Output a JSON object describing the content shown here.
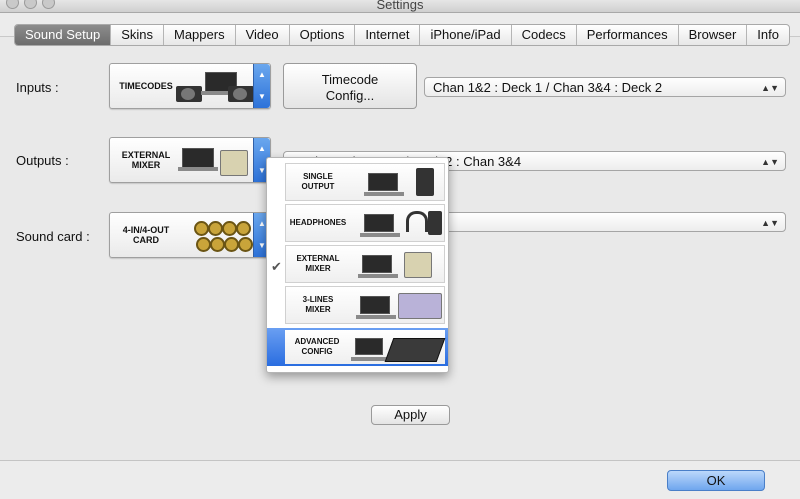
{
  "window": {
    "title": "Settings"
  },
  "tabs": [
    "Sound Setup",
    "Skins",
    "Mappers",
    "Video",
    "Options",
    "Internet",
    "iPhone/iPad",
    "Codecs",
    "Performances",
    "Browser",
    "Info"
  ],
  "active_tab": "Sound Setup",
  "inputs": {
    "label": "Inputs :",
    "device": "TIMECODES",
    "config_button": [
      "Timecode",
      "Config..."
    ],
    "routing": "Chan 1&2 : Deck 1 / Chan 3&4 : Deck 2"
  },
  "outputs": {
    "label": "Outputs :",
    "device": [
      "EXTERNAL",
      "MIXER"
    ],
    "routing": "Deck 1 : Chan 1&2 / Deck 2 : Chan 3&4"
  },
  "soundcard": {
    "label": "Sound card :",
    "device": [
      "4-IN/4-OUT",
      "CARD"
    ],
    "value": ""
  },
  "popup": {
    "items": [
      {
        "label": [
          "SINGLE",
          "OUTPUT"
        ],
        "icon": "single-output-icon"
      },
      {
        "label": [
          "HEADPHONES"
        ],
        "icon": "headphones-icon"
      },
      {
        "label": [
          "EXTERNAL",
          "MIXER"
        ],
        "icon": "external-mixer-icon",
        "checked": true
      },
      {
        "label": [
          "3-LINES",
          "MIXER"
        ],
        "icon": "three-lines-mixer-icon"
      },
      {
        "label": [
          "ADVANCED",
          "CONFIG"
        ],
        "icon": "advanced-config-icon",
        "highlighted": true
      }
    ],
    "check_glyph": "✔"
  },
  "apply_label": "Apply",
  "ok_label": "OK",
  "colors": {
    "accent": "#2d72d9",
    "tab_active": "#7a7a7a"
  }
}
